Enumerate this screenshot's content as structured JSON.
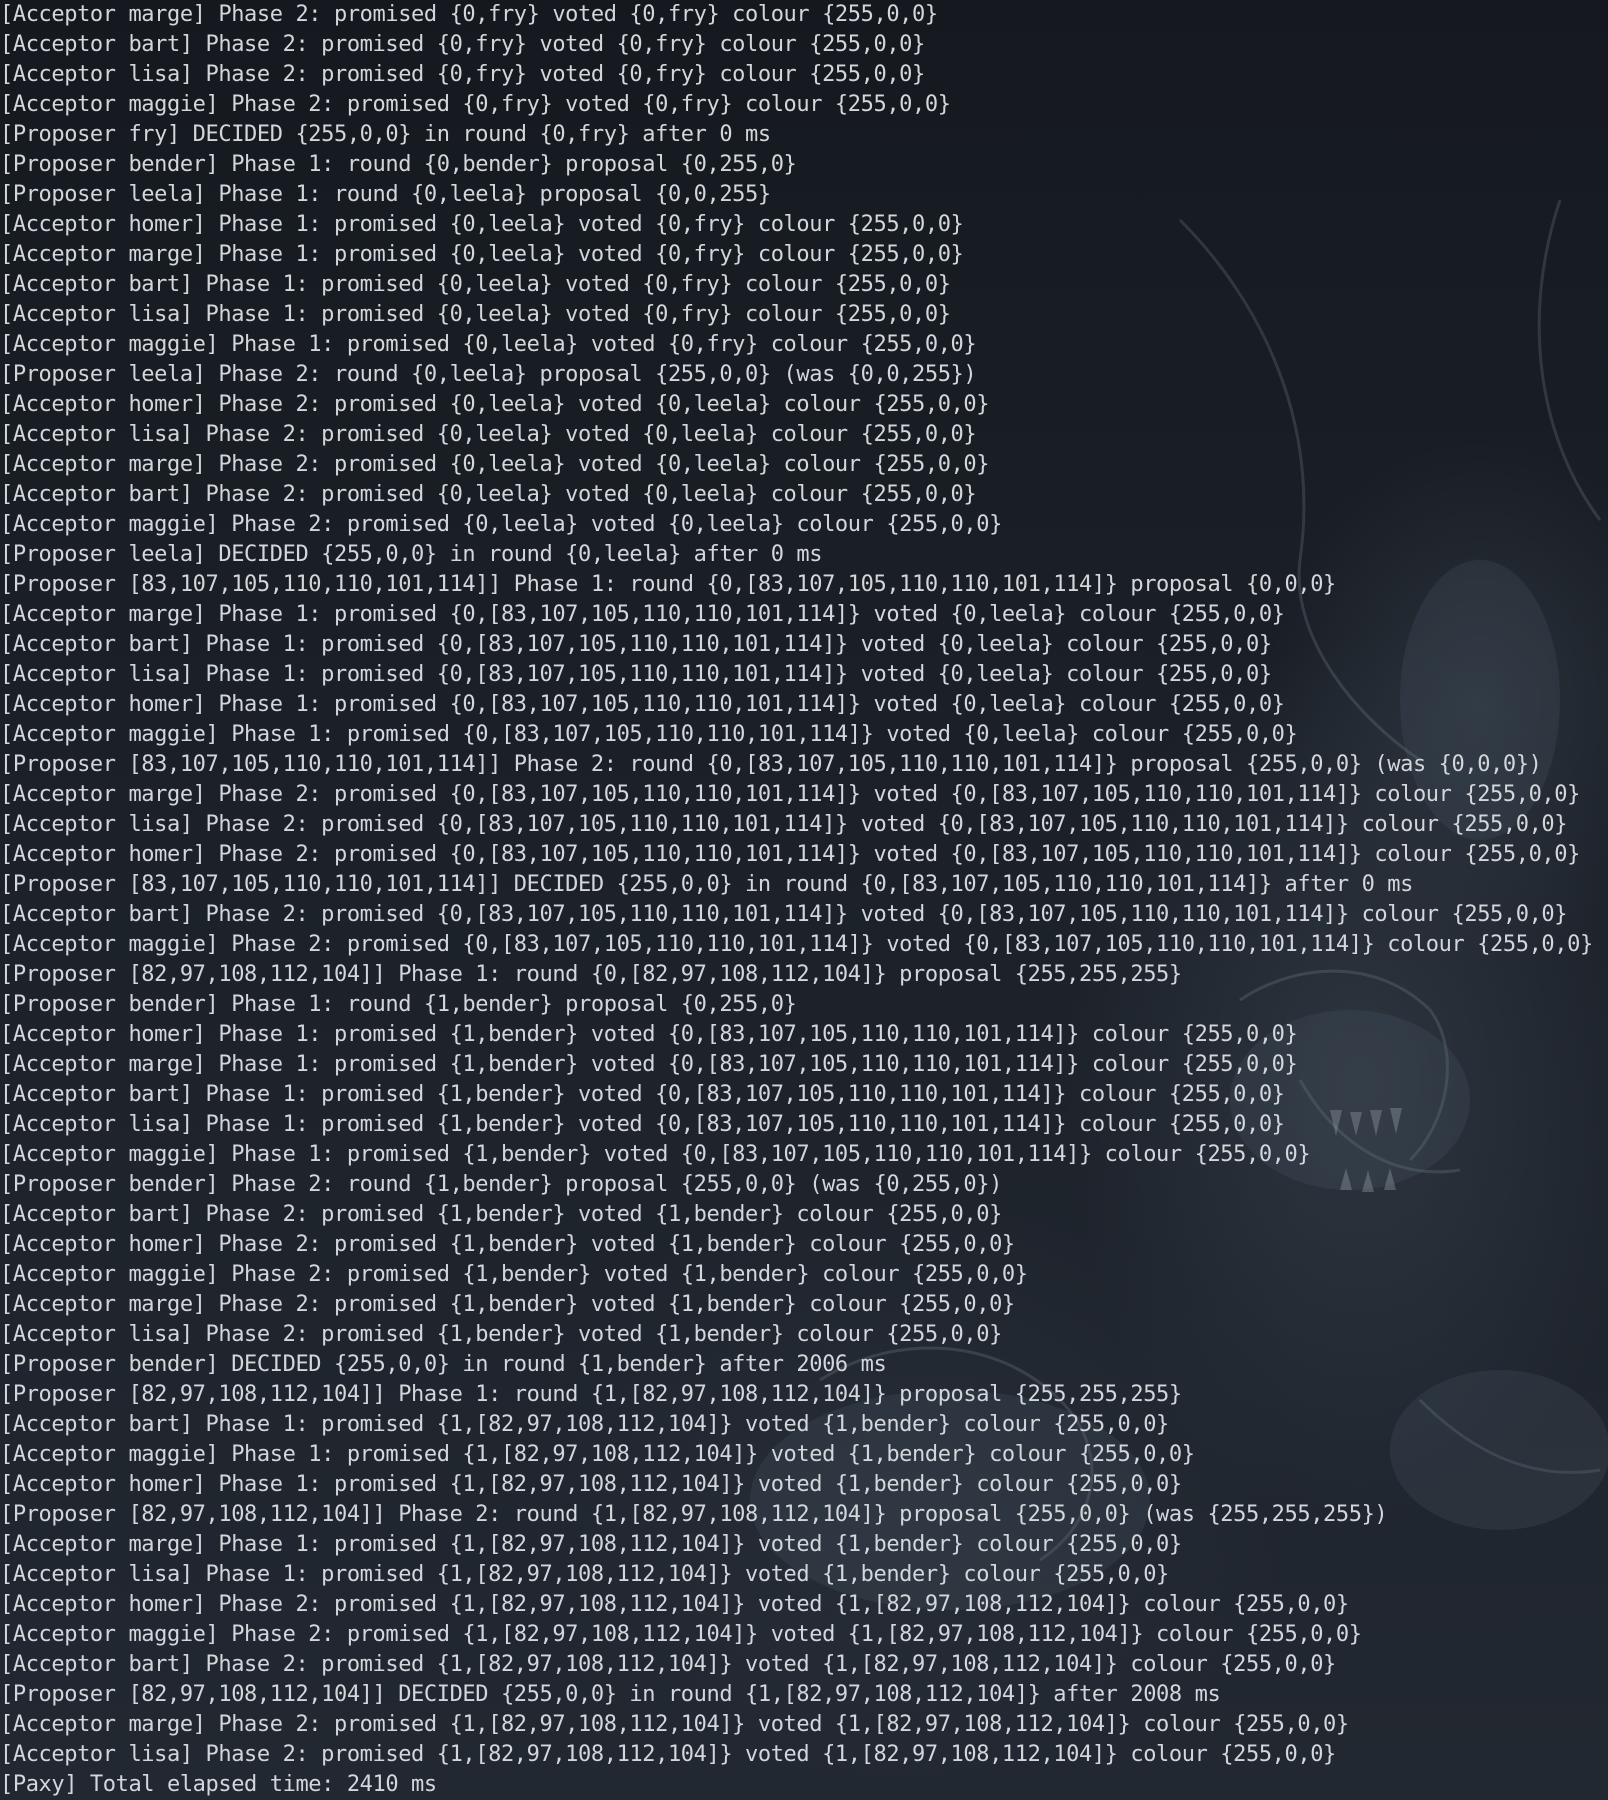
{
  "terminal": {
    "lines": [
      "[Acceptor marge] Phase 2: promised {0,fry} voted {0,fry} colour {255,0,0}",
      "[Acceptor bart] Phase 2: promised {0,fry} voted {0,fry} colour {255,0,0}",
      "[Acceptor lisa] Phase 2: promised {0,fry} voted {0,fry} colour {255,0,0}",
      "[Acceptor maggie] Phase 2: promised {0,fry} voted {0,fry} colour {255,0,0}",
      "[Proposer fry] DECIDED {255,0,0} in round {0,fry} after 0 ms",
      "[Proposer bender] Phase 1: round {0,bender} proposal {0,255,0}",
      "[Proposer leela] Phase 1: round {0,leela} proposal {0,0,255}",
      "[Acceptor homer] Phase 1: promised {0,leela} voted {0,fry} colour {255,0,0}",
      "[Acceptor marge] Phase 1: promised {0,leela} voted {0,fry} colour {255,0,0}",
      "[Acceptor bart] Phase 1: promised {0,leela} voted {0,fry} colour {255,0,0}",
      "[Acceptor lisa] Phase 1: promised {0,leela} voted {0,fry} colour {255,0,0}",
      "[Acceptor maggie] Phase 1: promised {0,leela} voted {0,fry} colour {255,0,0}",
      "[Proposer leela] Phase 2: round {0,leela} proposal {255,0,0} (was {0,0,255})",
      "[Acceptor homer] Phase 2: promised {0,leela} voted {0,leela} colour {255,0,0}",
      "[Acceptor lisa] Phase 2: promised {0,leela} voted {0,leela} colour {255,0,0}",
      "[Acceptor marge] Phase 2: promised {0,leela} voted {0,leela} colour {255,0,0}",
      "[Acceptor bart] Phase 2: promised {0,leela} voted {0,leela} colour {255,0,0}",
      "[Acceptor maggie] Phase 2: promised {0,leela} voted {0,leela} colour {255,0,0}",
      "[Proposer leela] DECIDED {255,0,0} in round {0,leela} after 0 ms",
      "[Proposer [83,107,105,110,110,101,114]] Phase 1: round {0,[83,107,105,110,110,101,114]} proposal {0,0,0}",
      "[Acceptor marge] Phase 1: promised {0,[83,107,105,110,110,101,114]} voted {0,leela} colour {255,0,0}",
      "[Acceptor bart] Phase 1: promised {0,[83,107,105,110,110,101,114]} voted {0,leela} colour {255,0,0}",
      "[Acceptor lisa] Phase 1: promised {0,[83,107,105,110,110,101,114]} voted {0,leela} colour {255,0,0}",
      "[Acceptor homer] Phase 1: promised {0,[83,107,105,110,110,101,114]} voted {0,leela} colour {255,0,0}",
      "[Acceptor maggie] Phase 1: promised {0,[83,107,105,110,110,101,114]} voted {0,leela} colour {255,0,0}",
      "[Proposer [83,107,105,110,110,101,114]] Phase 2: round {0,[83,107,105,110,110,101,114]} proposal {255,0,0} (was {0,0,0})",
      "[Acceptor marge] Phase 2: promised {0,[83,107,105,110,110,101,114]} voted {0,[83,107,105,110,110,101,114]} colour {255,0,0}",
      "[Acceptor lisa] Phase 2: promised {0,[83,107,105,110,110,101,114]} voted {0,[83,107,105,110,110,101,114]} colour {255,0,0}",
      "[Acceptor homer] Phase 2: promised {0,[83,107,105,110,110,101,114]} voted {0,[83,107,105,110,110,101,114]} colour {255,0,0}",
      "[Proposer [83,107,105,110,110,101,114]] DECIDED {255,0,0} in round {0,[83,107,105,110,110,101,114]} after 0 ms",
      "[Acceptor bart] Phase 2: promised {0,[83,107,105,110,110,101,114]} voted {0,[83,107,105,110,110,101,114]} colour {255,0,0}",
      "[Acceptor maggie] Phase 2: promised {0,[83,107,105,110,110,101,114]} voted {0,[83,107,105,110,110,101,114]} colour {255,0,0}",
      "[Proposer [82,97,108,112,104]] Phase 1: round {0,[82,97,108,112,104]} proposal {255,255,255}",
      "[Proposer bender] Phase 1: round {1,bender} proposal {0,255,0}",
      "[Acceptor homer] Phase 1: promised {1,bender} voted {0,[83,107,105,110,110,101,114]} colour {255,0,0}",
      "[Acceptor marge] Phase 1: promised {1,bender} voted {0,[83,107,105,110,110,101,114]} colour {255,0,0}",
      "[Acceptor bart] Phase 1: promised {1,bender} voted {0,[83,107,105,110,110,101,114]} colour {255,0,0}",
      "[Acceptor lisa] Phase 1: promised {1,bender} voted {0,[83,107,105,110,110,101,114]} colour {255,0,0}",
      "[Acceptor maggie] Phase 1: promised {1,bender} voted {0,[83,107,105,110,110,101,114]} colour {255,0,0}",
      "[Proposer bender] Phase 2: round {1,bender} proposal {255,0,0} (was {0,255,0})",
      "[Acceptor bart] Phase 2: promised {1,bender} voted {1,bender} colour {255,0,0}",
      "[Acceptor homer] Phase 2: promised {1,bender} voted {1,bender} colour {255,0,0}",
      "[Acceptor maggie] Phase 2: promised {1,bender} voted {1,bender} colour {255,0,0}",
      "[Acceptor marge] Phase 2: promised {1,bender} voted {1,bender} colour {255,0,0}",
      "[Acceptor lisa] Phase 2: promised {1,bender} voted {1,bender} colour {255,0,0}",
      "[Proposer bender] DECIDED {255,0,0} in round {1,bender} after 2006 ms",
      "[Proposer [82,97,108,112,104]] Phase 1: round {1,[82,97,108,112,104]} proposal {255,255,255}",
      "[Acceptor bart] Phase 1: promised {1,[82,97,108,112,104]} voted {1,bender} colour {255,0,0}",
      "[Acceptor maggie] Phase 1: promised {1,[82,97,108,112,104]} voted {1,bender} colour {255,0,0}",
      "[Acceptor homer] Phase 1: promised {1,[82,97,108,112,104]} voted {1,bender} colour {255,0,0}",
      "[Proposer [82,97,108,112,104]] Phase 2: round {1,[82,97,108,112,104]} proposal {255,0,0} (was {255,255,255})",
      "[Acceptor marge] Phase 1: promised {1,[82,97,108,112,104]} voted {1,bender} colour {255,0,0}",
      "[Acceptor lisa] Phase 1: promised {1,[82,97,108,112,104]} voted {1,bender} colour {255,0,0}",
      "[Acceptor homer] Phase 2: promised {1,[82,97,108,112,104]} voted {1,[82,97,108,112,104]} colour {255,0,0}",
      "[Acceptor maggie] Phase 2: promised {1,[82,97,108,112,104]} voted {1,[82,97,108,112,104]} colour {255,0,0}",
      "[Acceptor bart] Phase 2: promised {1,[82,97,108,112,104]} voted {1,[82,97,108,112,104]} colour {255,0,0}",
      "[Proposer [82,97,108,112,104]] DECIDED {255,0,0} in round {1,[82,97,108,112,104]} after 2008 ms",
      "[Acceptor marge] Phase 2: promised {1,[82,97,108,112,104]} voted {1,[82,97,108,112,104]} colour {255,0,0}",
      "[Acceptor lisa] Phase 2: promised {1,[82,97,108,112,104]} voted {1,[82,97,108,112,104]} colour {255,0,0}",
      "[Paxy] Total elapsed time: 2410 ms"
    ]
  },
  "theme": {
    "background": "#1c2129",
    "foreground": "#d3d6db"
  }
}
